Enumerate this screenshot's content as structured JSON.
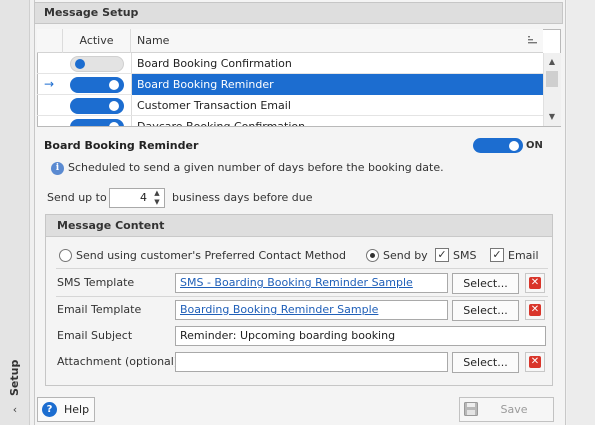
{
  "side_tab": {
    "label": "Setup",
    "collapse_glyph": "‹"
  },
  "header": {
    "title": "Message Setup"
  },
  "grid": {
    "columns": {
      "active": "Active",
      "name": "Name"
    },
    "rows": [
      {
        "name": "Board Booking Confirmation",
        "active": false
      },
      {
        "name": "Board Booking Reminder",
        "active": true,
        "selected": true
      },
      {
        "name": "Customer Transaction Email",
        "active": true
      },
      {
        "name": "Daycare Booking Confirmation",
        "active": true
      }
    ],
    "selected_row_indicator": "→"
  },
  "detail": {
    "title": "Board Booking Reminder",
    "toggle_state": "ON",
    "info_text": "Scheduled to send a given number of days before the booking date.",
    "send_up_to_label": "Send up to",
    "days_value": "4",
    "days_suffix": "business days before due"
  },
  "message_content": {
    "title": "Message Content",
    "preferred_label": "Send using customer's Preferred Contact Method",
    "send_by_label": "Send by",
    "sms_label": "SMS",
    "email_label": "Email",
    "sms_checked": "✓",
    "email_checked": "✓",
    "sms_template_label": "SMS Template",
    "sms_template_value": "SMS - Boarding Booking Reminder Sample",
    "email_template_label": "Email Template",
    "email_template_value": "Boarding Booking Reminder Sample",
    "email_subject_label": "Email Subject",
    "email_subject_value": "Reminder: Upcoming boarding booking",
    "attachment_label": "Attachment (optional)",
    "attachment_value": "",
    "select_label": "Select..."
  },
  "footer": {
    "help_label": "Help",
    "save_label": "Save"
  },
  "colors": {
    "accent": "#1c6dd0",
    "delete": "#d9352a",
    "link": "#1f5fb8"
  }
}
